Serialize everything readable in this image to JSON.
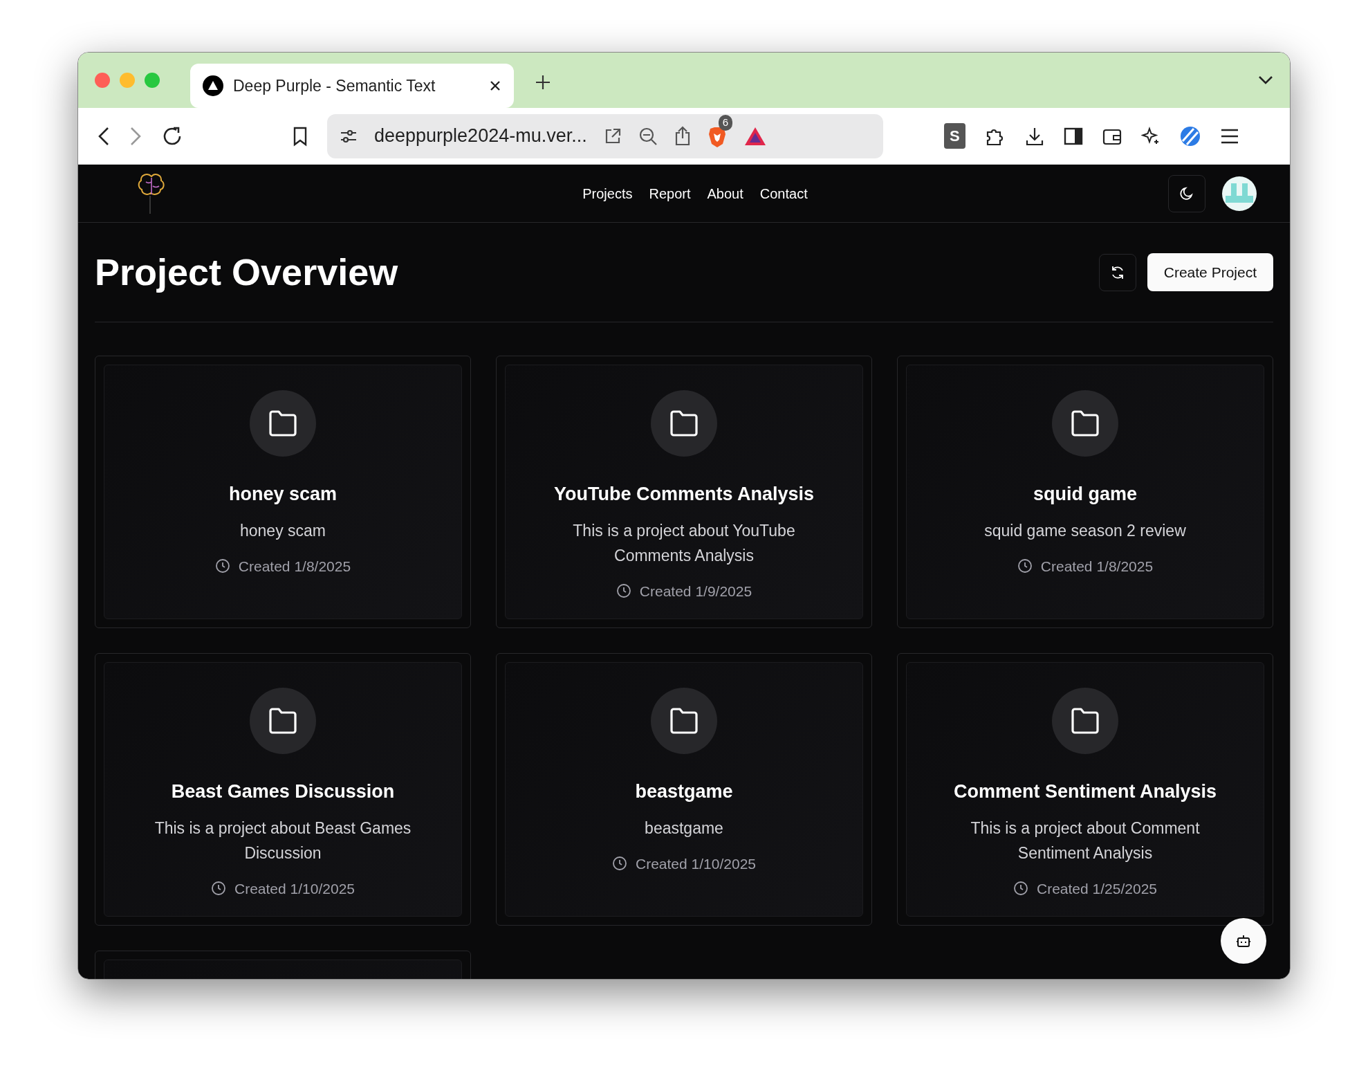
{
  "browser": {
    "tab_title": "Deep Purple - Semantic Text",
    "url": "deeppurple2024-mu.ver...",
    "shield_badge": "6",
    "extension_letter": "S"
  },
  "nav": {
    "links": [
      "Projects",
      "Report",
      "About",
      "Contact"
    ]
  },
  "header": {
    "title": "Project Overview",
    "create_button": "Create Project"
  },
  "projects": [
    {
      "name": "honey scam",
      "description": "honey scam",
      "created": "Created 1/8/2025"
    },
    {
      "name": "YouTube Comments Analysis",
      "description": "This is a project about YouTube Comments Analysis",
      "created": "Created 1/9/2025"
    },
    {
      "name": "squid game",
      "description": "squid game season 2 review",
      "created": "Created 1/8/2025"
    },
    {
      "name": "Beast Games Discussion",
      "description": "This is a project about Beast Games Discussion",
      "created": "Created 1/10/2025"
    },
    {
      "name": "beastgame",
      "description": "beastgame",
      "created": "Created 1/10/2025"
    },
    {
      "name": "Comment Sentiment Analysis",
      "description": "This is a project about Comment Sentiment Analysis",
      "created": "Created 1/25/2025"
    }
  ]
}
